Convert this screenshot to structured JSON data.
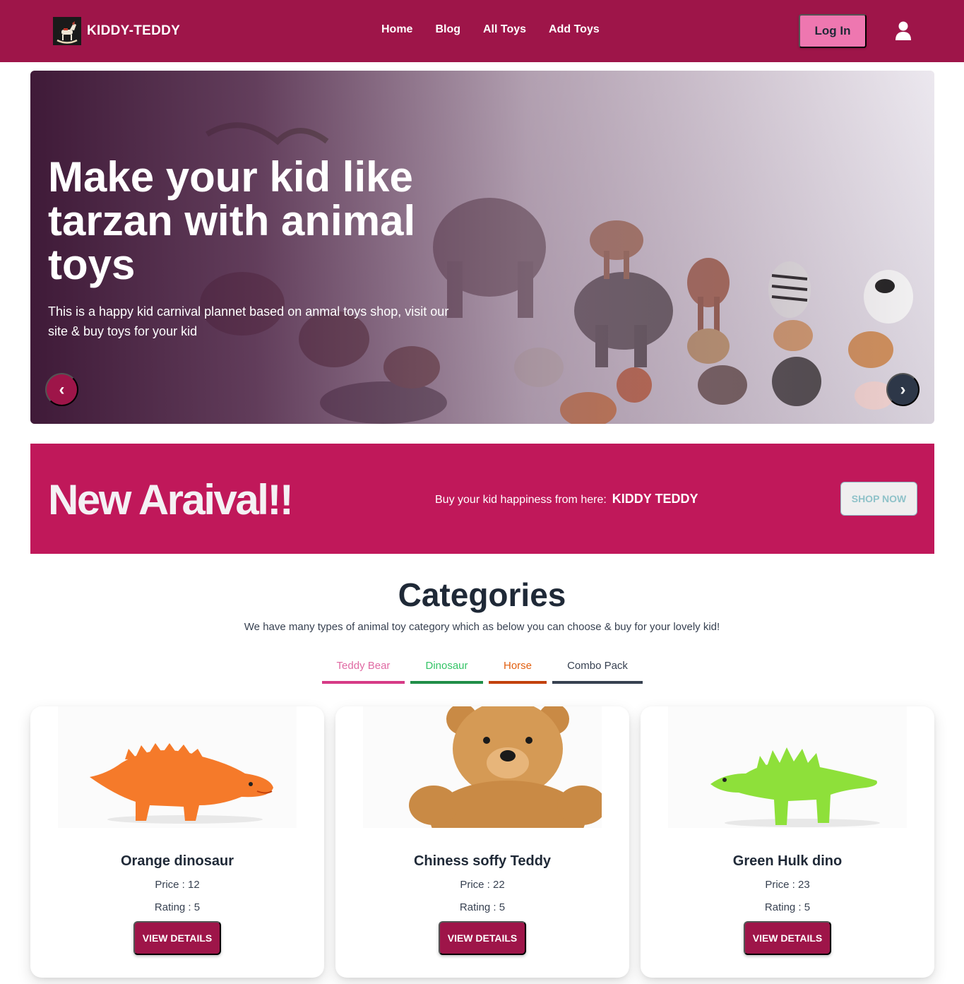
{
  "brand": {
    "name": "KIDDY-TEDDY",
    "logo": "rocking-horse-logo"
  },
  "nav": {
    "links": [
      {
        "label": "Home"
      },
      {
        "label": "Blog"
      },
      {
        "label": "All Toys"
      },
      {
        "label": "Add Toys"
      }
    ],
    "login_label": "Log In",
    "user_icon": "user-icon"
  },
  "hero": {
    "title": "Make your kid like tarzan with animal toys",
    "text": "This is a happy kid carnival plannet based on anmal toys shop, visit our site & buy toys for your kid",
    "prev_label": "‹",
    "next_label": "›"
  },
  "arrival": {
    "title": "New Araival!!",
    "tagline": "Buy your kid happiness from here:",
    "brand": "KIDDY TEDDY",
    "button_label": "SHOP NOW"
  },
  "categories": {
    "title": "Categories",
    "subtitle": "We have many types of animal toy category which as below you can choose & buy for your lovely kid!",
    "tabs": [
      {
        "label": "Teddy Bear"
      },
      {
        "label": "Dinosaur"
      },
      {
        "label": "Horse"
      },
      {
        "label": "Combo Pack"
      }
    ]
  },
  "products": [
    {
      "name": "Orange dinosaur",
      "price": "Price : 12",
      "rating": "Rating : 5",
      "button": "VIEW DETAILS"
    },
    {
      "name": "Chiness soffy Teddy",
      "price": "Price : 22",
      "rating": "Rating : 5",
      "button": "VIEW DETAILS"
    },
    {
      "name": "Green Hulk dino",
      "price": "Price : 23",
      "rating": "Rating : 5",
      "button": "VIEW DETAILS"
    }
  ],
  "colors": {
    "navbar": "#9e1549",
    "login_button": "#ee77b0",
    "arrival_banner": "#c0185a",
    "primary_button": "#9e1549",
    "tab_teddy": "#d63a86",
    "tab_dinosaur": "#208e48",
    "tab_horse": "#c2410c",
    "tab_combo": "#374151"
  }
}
